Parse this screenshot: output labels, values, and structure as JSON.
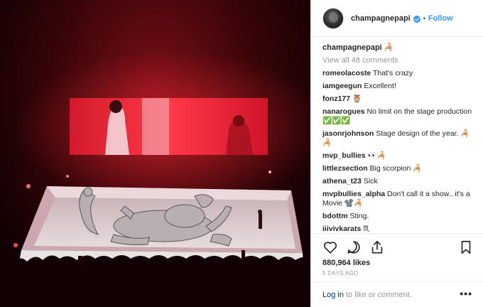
{
  "post": {
    "username": "champagnepapi",
    "follow_label": "Follow",
    "caption_user": "champagnepapi",
    "caption_text": "🦂",
    "view_all": "View all 48 comments",
    "likes": "880,964 likes",
    "age": "5 DAYS AGO",
    "login_label": "Log in",
    "login_suffix": "to like or comment.",
    "more_label": "•••"
  },
  "comments": [
    {
      "user": "romeolacoste",
      "text": "That's crazy"
    },
    {
      "user": "iamgeegun",
      "text": "Excellent!"
    },
    {
      "user": "fonz177",
      "text": "🦉"
    },
    {
      "user": "nanarogues",
      "text": "No limit on the stage production ✅✅✅"
    },
    {
      "user": "jasonrjohnson",
      "text": "Stage design of the year. 🦂🦂"
    },
    {
      "user": "mvp_bullies",
      "text": "👀🦂"
    },
    {
      "user": "littlezsection",
      "text": "Big scorpion 🦂"
    },
    {
      "user": "athena_t23",
      "text": "Sick"
    },
    {
      "user": "mvpbullies_alpha",
      "text": "Don't call it a show.. it's a Movie 📽️🦂"
    },
    {
      "user": "bdottm",
      "text": "Sting."
    },
    {
      "user": "iiivivkarats",
      "text": "♏"
    }
  ],
  "colors": {
    "accent": "#3897f0",
    "stage_red": "#e0202e",
    "muted": "#999999"
  },
  "icons": [
    "verified-badge-icon",
    "heart-icon",
    "comment-icon",
    "share-icon",
    "bookmark-icon",
    "more-options-icon"
  ]
}
